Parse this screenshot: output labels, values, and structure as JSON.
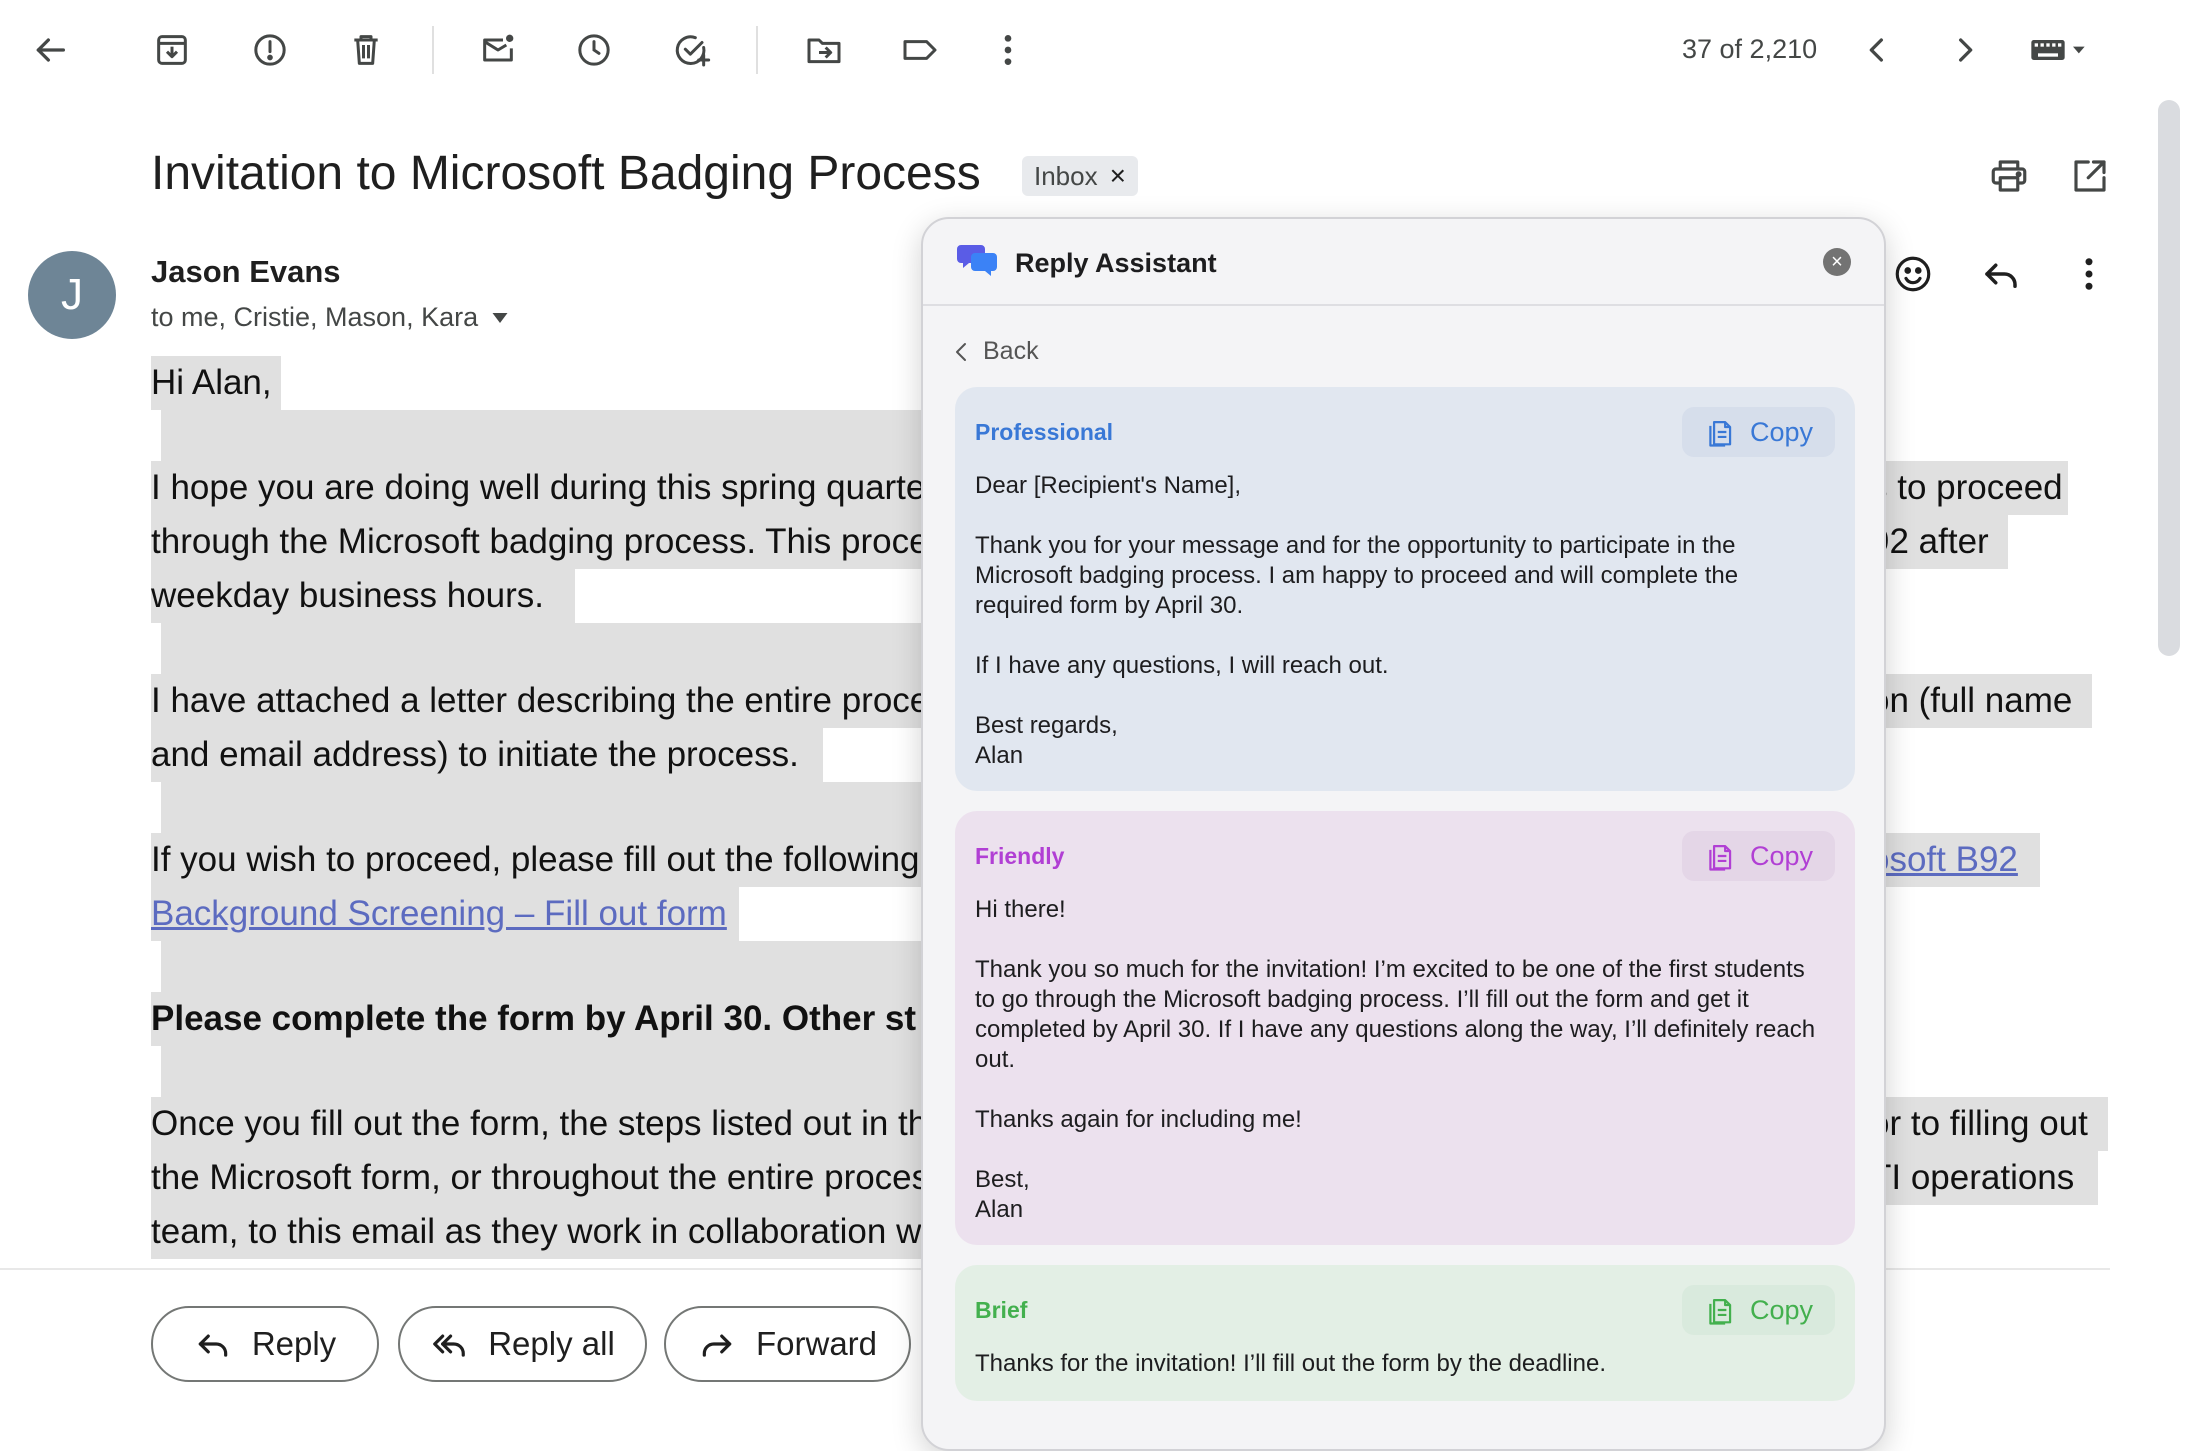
{
  "toolbar": {
    "icons": [
      "back-arrow-icon",
      "archive-icon",
      "report-spam-icon",
      "delete-icon",
      "mark-unread-icon",
      "snooze-icon",
      "add-to-tasks-icon",
      "move-to-icon",
      "label-icon",
      "more-vert-icon"
    ],
    "pager": "37 of 2,210"
  },
  "email": {
    "subject": "Invitation to Microsoft Badging Process",
    "label_chip": "Inbox",
    "label_chip_close": "×",
    "sender_initial": "J",
    "sender_name": "Jason Evans",
    "recipients": "to me, Cristie, Mason, Kara",
    "body": {
      "greeting": "Hi Alan,",
      "p1_line1_left": "I hope you are doing well during this spring quarte",
      "p1_line1_right": "s to proceed",
      "p1_line2_left": "through the Microsoft badging process. This proce",
      "p1_line2_right": "92 after",
      "p1_line3": "weekday business hours.",
      "p2_line1_left": "I have attached a letter describing the entire proce",
      "p2_line1_right": "on (full name",
      "p2_line2": "and email address) to initiate the process.",
      "p3_line1_left": "If you wish to proceed, please fill out the following",
      "p3_line1_right_link": "osoft B92",
      "p3_line2_link": "Background Screening – Fill out form",
      "p4_bold": "Please complete the form by April 30. Other st",
      "p5_line1_left": "Once you fill out the form, the steps listed out in th",
      "p5_line1_right": "or to filling out",
      "p5_line2_left": "the Microsoft form, or throughout the entire proces",
      "p5_line2_right": "TI operations",
      "p5_line3_left": "team, to this email as they work in collaboration w"
    }
  },
  "actions": {
    "reply": "Reply",
    "reply_all": "Reply all",
    "forward": "Forward"
  },
  "assistant": {
    "title": "Reply Assistant",
    "close": "×",
    "back": "Back",
    "copy_label": "Copy",
    "cards": {
      "professional": {
        "label": "Professional",
        "paragraphs": [
          "Dear [Recipient's Name],",
          "Thank you for your message and for the opportunity to participate in the Microsoft badging process. I am happy to proceed and will complete the required form by April 30.",
          "If I have any questions, I will reach out.",
          "Best regards,\nAlan"
        ]
      },
      "friendly": {
        "label": "Friendly",
        "paragraphs": [
          "Hi there!",
          "Thank you so much for the invitation! I’m excited to be one of the first students to go through the Microsoft badging process. I’ll fill out the form and get it completed by April 30. If I have any questions along the way, I’ll definitely reach out.",
          "Thanks again for including me!",
          "Best,\nAlan"
        ]
      },
      "brief": {
        "label": "Brief",
        "paragraphs": [
          "Thanks for the invitation! I’ll fill out the form by the deadline."
        ]
      }
    },
    "colors": {
      "professional": "#3978d6",
      "friendly": "#b13fd4",
      "brief": "#43b04e"
    }
  }
}
